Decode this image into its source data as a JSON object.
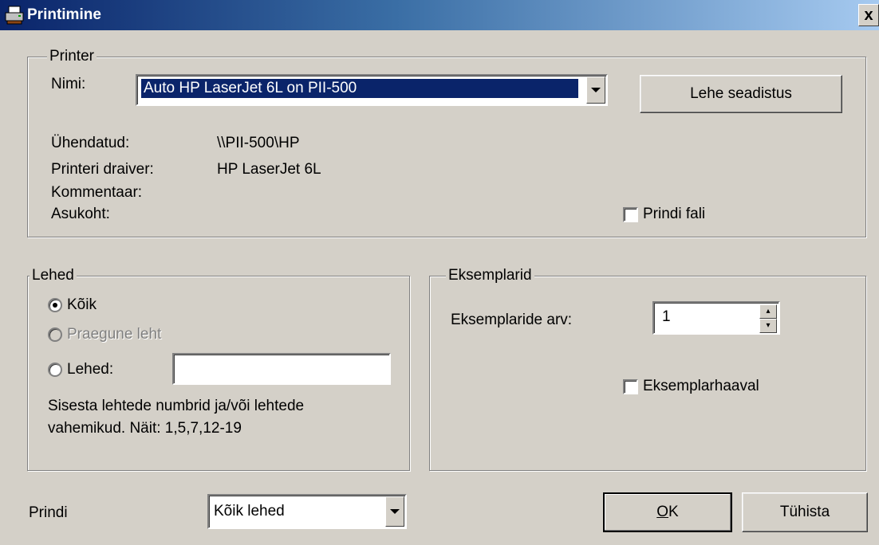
{
  "window": {
    "title": "Printimine",
    "close_label": "x"
  },
  "printer": {
    "legend": "Printer",
    "name_label": "Nimi:",
    "name_value": "Auto HP LaserJet 6L on PII-500",
    "page_setup_button": "Lehe seadistus",
    "connected_label": "Ühendatud:",
    "connected_value": "\\\\PII-500\\HP",
    "driver_label": "Printeri draiver:",
    "driver_value": "HP LaserJet 6L",
    "comment_label": "Kommentaar:",
    "location_label": "Asukoht:",
    "print_to_file_label": "Prindi fali"
  },
  "pages": {
    "legend": "Lehed",
    "all_label": "Kõik",
    "current_label": "Praegune leht",
    "pages_label": "Lehed:",
    "pages_value": "",
    "hint_line1": "Sisesta lehtede numbrid ja/või lehtede",
    "hint_line2": "vahemikud. Näit: 1,5,7,12-19"
  },
  "copies": {
    "legend": "Eksemplarid",
    "count_label": "Eksemplaride arv:",
    "count_value": "1",
    "collate_label": "Eksemplarhaaval"
  },
  "footer": {
    "print_label": "Prindi",
    "print_select_value": "Kõik lehed",
    "ok_mnemonic": "O",
    "ok_rest": "K",
    "cancel_button": "Tühista"
  }
}
